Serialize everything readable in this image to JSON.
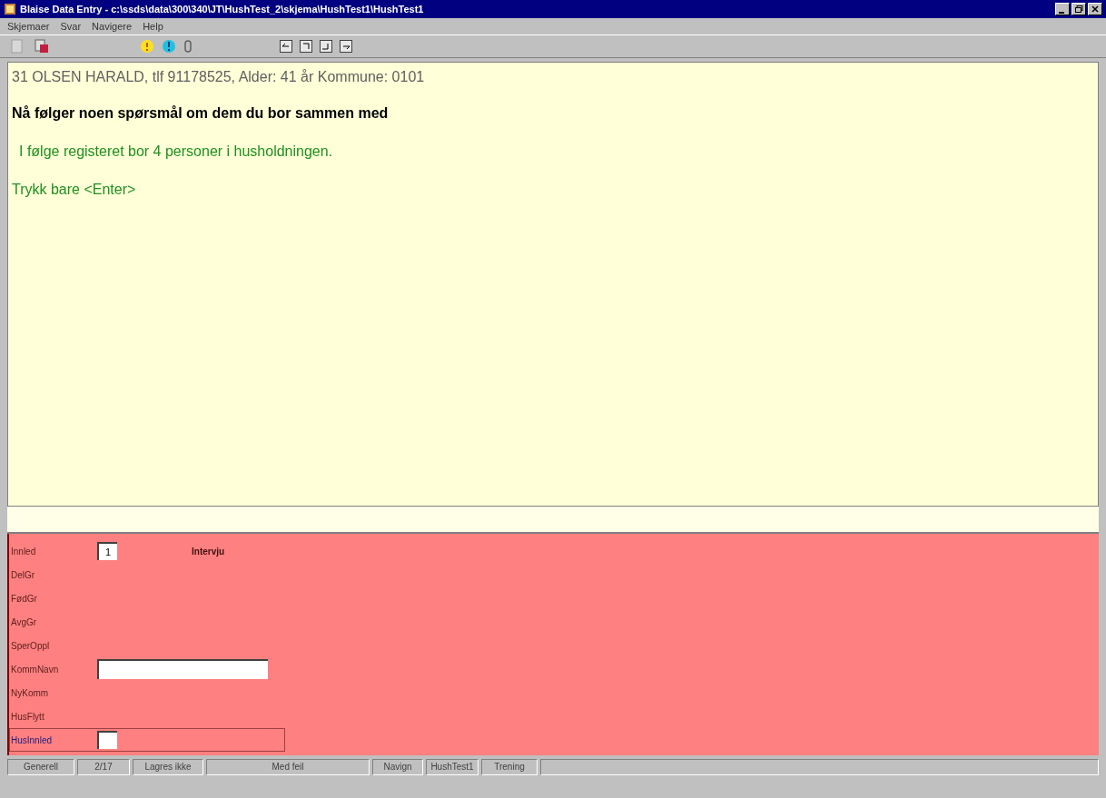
{
  "window": {
    "title": "Blaise Data Entry - c:\\ssds\\data\\300\\340\\JT\\HushTest_2\\skjema\\HushTest1\\HushTest1"
  },
  "menu": [
    "Skjemaer",
    "Svar",
    "Navigere",
    "Help"
  ],
  "question": {
    "header": "31 OLSEN HARALD,  tlf 91178525, Alder:  41 år Kommune: 0101",
    "heading": "Nå følger noen spørsmål om dem du bor sammen med",
    "info": "I følge registeret bor 4 personer i husholdningen.",
    "instruction": "Trykk bare <Enter>"
  },
  "fields": [
    {
      "label": "Innled",
      "kind": "small",
      "value": "1",
      "note": "Intervju",
      "current": false
    },
    {
      "label": "DelGr",
      "kind": "none",
      "current": false
    },
    {
      "label": "FødGr",
      "kind": "none",
      "current": false
    },
    {
      "label": "AvgGr",
      "kind": "none",
      "current": false
    },
    {
      "label": "SperOppl",
      "kind": "none",
      "current": false
    },
    {
      "label": "KommNavn",
      "kind": "wide",
      "current": false
    },
    {
      "label": "NyKomm",
      "kind": "none",
      "current": false
    },
    {
      "label": "HusFlytt",
      "kind": "none",
      "current": false
    },
    {
      "label": "HusInnled",
      "kind": "small",
      "current": true
    }
  ],
  "status_bar": [
    "Generell",
    "2/17",
    "Lagres ikke",
    "Med feil",
    "Navign",
    "HushTest1",
    "Trening"
  ]
}
